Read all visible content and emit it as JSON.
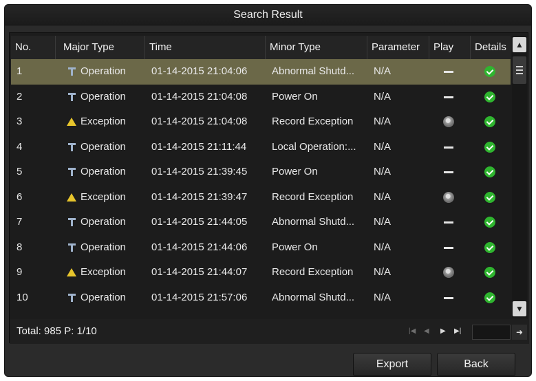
{
  "dialog": {
    "title": "Search Result"
  },
  "table": {
    "headers": {
      "no": "No.",
      "major": "Major Type",
      "time": "Time",
      "minor": "Minor Type",
      "param": "Parameter",
      "play": "Play",
      "details": "Details"
    },
    "rows": [
      {
        "no": "1",
        "major": "Operation",
        "icon": "operation-icon",
        "time": "01-14-2015 21:04:06",
        "minor": "Abnormal Shutd...",
        "param": "N/A",
        "play": "none",
        "selected": true
      },
      {
        "no": "2",
        "major": "Operation",
        "icon": "operation-icon",
        "time": "01-14-2015 21:04:08",
        "minor": "Power On",
        "param": "N/A",
        "play": "none"
      },
      {
        "no": "3",
        "major": "Exception",
        "icon": "warning-icon",
        "time": "01-14-2015 21:04:08",
        "minor": "Record Exception",
        "param": "N/A",
        "play": "play"
      },
      {
        "no": "4",
        "major": "Operation",
        "icon": "operation-icon",
        "time": "01-14-2015 21:11:44",
        "minor": "Local Operation:...",
        "param": "N/A",
        "play": "none"
      },
      {
        "no": "5",
        "major": "Operation",
        "icon": "operation-icon",
        "time": "01-14-2015 21:39:45",
        "minor": "Power On",
        "param": "N/A",
        "play": "none"
      },
      {
        "no": "6",
        "major": "Exception",
        "icon": "warning-icon",
        "time": "01-14-2015 21:39:47",
        "minor": "Record Exception",
        "param": "N/A",
        "play": "play"
      },
      {
        "no": "7",
        "major": "Operation",
        "icon": "operation-icon",
        "time": "01-14-2015 21:44:05",
        "minor": "Abnormal Shutd...",
        "param": "N/A",
        "play": "none"
      },
      {
        "no": "8",
        "major": "Operation",
        "icon": "operation-icon",
        "time": "01-14-2015 21:44:06",
        "minor": "Power On",
        "param": "N/A",
        "play": "none"
      },
      {
        "no": "9",
        "major": "Exception",
        "icon": "warning-icon",
        "time": "01-14-2015 21:44:07",
        "minor": "Record Exception",
        "param": "N/A",
        "play": "play"
      },
      {
        "no": "10",
        "major": "Operation",
        "icon": "operation-icon",
        "time": "01-14-2015 21:57:06",
        "minor": "Abnormal Shutd...",
        "param": "N/A",
        "play": "none"
      }
    ]
  },
  "footer": {
    "total": "Total: 985  P: 1/10",
    "page_input": ""
  },
  "buttons": {
    "export": "Export",
    "back": "Back"
  },
  "colors": {
    "selected_row": "#6b6848",
    "check": "#2fb52f",
    "warning": "#e7c52c"
  }
}
